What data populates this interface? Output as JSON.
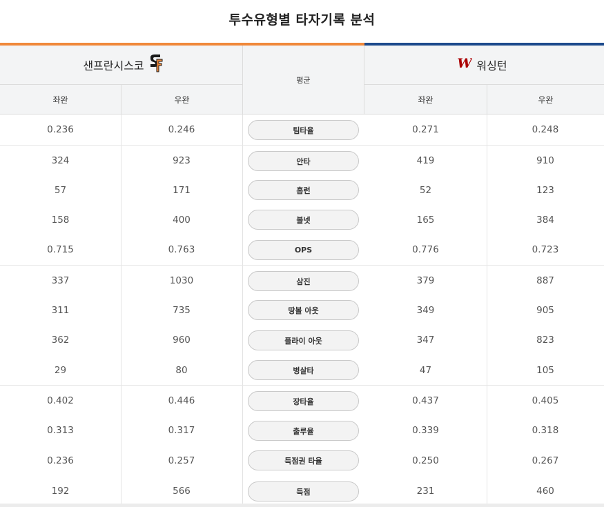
{
  "title": "투수유형별 타자기록 분석",
  "colors": {
    "sf_orange": "#f0883a",
    "wsh_blue": "#1c4a8c"
  },
  "teams": {
    "left": {
      "name": "샌프란시스코",
      "logo": "sf-giants-logo-icon"
    },
    "right": {
      "name": "워싱턴",
      "logo": "nationals-logo-icon"
    }
  },
  "average_label": "평균",
  "subheads": {
    "lhp": "좌완",
    "rhp": "우완"
  },
  "rows": [
    {
      "stat": "팀타율",
      "sf_l": "0.236",
      "sf_r": "0.246",
      "wsh_l": "0.271",
      "wsh_r": "0.248"
    },
    {
      "stat": "안타",
      "sf_l": "324",
      "sf_r": "923",
      "wsh_l": "419",
      "wsh_r": "910"
    },
    {
      "stat": "홈런",
      "sf_l": "57",
      "sf_r": "171",
      "wsh_l": "52",
      "wsh_r": "123"
    },
    {
      "stat": "볼넷",
      "sf_l": "158",
      "sf_r": "400",
      "wsh_l": "165",
      "wsh_r": "384"
    },
    {
      "stat": "OPS",
      "sf_l": "0.715",
      "sf_r": "0.763",
      "wsh_l": "0.776",
      "wsh_r": "0.723"
    },
    {
      "stat": "삼진",
      "sf_l": "337",
      "sf_r": "1030",
      "wsh_l": "379",
      "wsh_r": "887"
    },
    {
      "stat": "땅볼 아웃",
      "sf_l": "311",
      "sf_r": "735",
      "wsh_l": "349",
      "wsh_r": "905"
    },
    {
      "stat": "플라이 아웃",
      "sf_l": "362",
      "sf_r": "960",
      "wsh_l": "347",
      "wsh_r": "823"
    },
    {
      "stat": "병살타",
      "sf_l": "29",
      "sf_r": "80",
      "wsh_l": "47",
      "wsh_r": "105"
    },
    {
      "stat": "장타율",
      "sf_l": "0.402",
      "sf_r": "0.446",
      "wsh_l": "0.437",
      "wsh_r": "0.405"
    },
    {
      "stat": "출루율",
      "sf_l": "0.313",
      "sf_r": "0.317",
      "wsh_l": "0.339",
      "wsh_r": "0.318"
    },
    {
      "stat": "득점권 타율",
      "sf_l": "0.236",
      "sf_r": "0.257",
      "wsh_l": "0.250",
      "wsh_r": "0.267"
    },
    {
      "stat": "득점",
      "sf_l": "192",
      "sf_r": "566",
      "wsh_l": "231",
      "wsh_r": "460"
    }
  ]
}
